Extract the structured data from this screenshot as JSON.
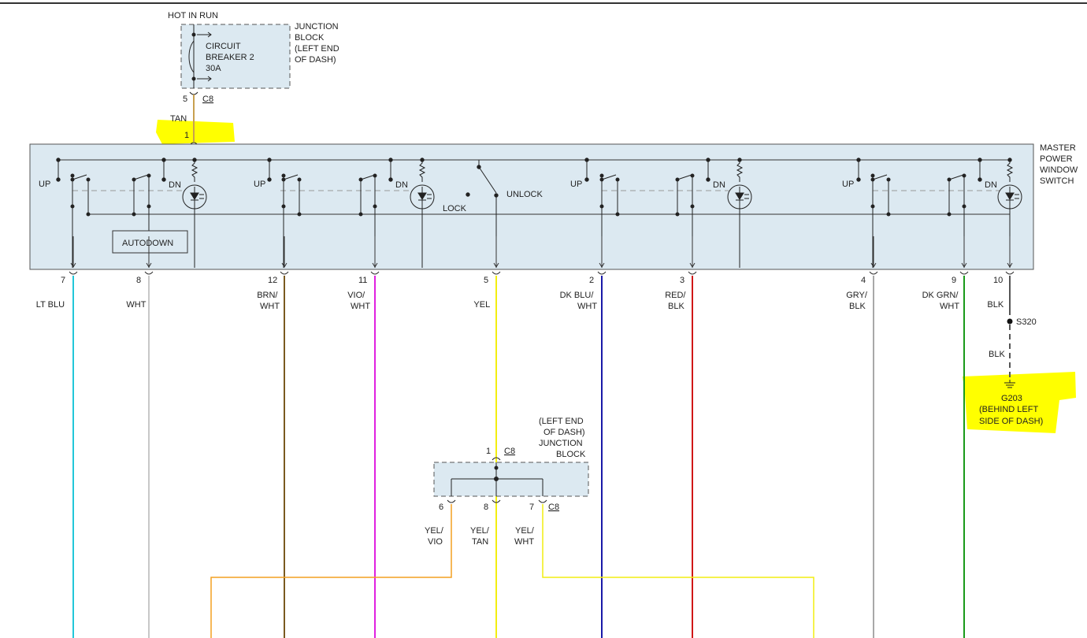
{
  "power": {
    "hot_in_run": "HOT IN RUN",
    "breaker_line1": "CIRCUIT",
    "breaker_line2": "BREAKER 2",
    "breaker_rating": "30A",
    "jb_line1": "JUNCTION",
    "jb_line2": "BLOCK",
    "jb_line3": "(LEFT END",
    "jb_line4": "OF DASH)",
    "out_pin": "5",
    "out_connector": "C8",
    "wire_color": "TAN",
    "switch_in_pin": "1"
  },
  "switch": {
    "name_line1": "MASTER",
    "name_line2": "POWER",
    "name_line3": "WINDOW",
    "name_line4": "SWITCH",
    "up_label": "UP",
    "dn_label": "DN",
    "autodown_label": "AUTODOWN",
    "lock_label": "LOCK",
    "unlock_label": "UNLOCK"
  },
  "pins": [
    {
      "pin": "7",
      "wire1": "LT BLU",
      "wire2": "",
      "color": "#22c7d9"
    },
    {
      "pin": "8",
      "wire1": "WHT",
      "wire2": "",
      "color": "#c8c8c8"
    },
    {
      "pin": "12",
      "wire1": "BRN/",
      "wire2": "WHT",
      "color": "#7a5a20"
    },
    {
      "pin": "11",
      "wire1": "VIO/",
      "wire2": "WHT",
      "color": "#e020e0"
    },
    {
      "pin": "5",
      "wire1": "YEL",
      "wire2": "",
      "color": "#f2ee10"
    },
    {
      "pin": "2",
      "wire1": "DK BLU/",
      "wire2": "WHT",
      "color": "#1a1aa8"
    },
    {
      "pin": "3",
      "wire1": "RED/",
      "wire2": "BLK",
      "color": "#d01818"
    },
    {
      "pin": "4",
      "wire1": "GRY/",
      "wire2": "BLK",
      "color": "#a8a8a8"
    },
    {
      "pin": "9",
      "wire1": "DK GRN/",
      "wire2": "WHT",
      "color": "#1a9a1a"
    },
    {
      "pin": "10",
      "wire1": "BLK",
      "wire2": "",
      "color": "#555555"
    }
  ],
  "ground": {
    "splice": "S320",
    "wire_color": "BLK",
    "ground_id": "G203",
    "loc_line1": "(BEHIND LEFT",
    "loc_line2": "SIDE OF DASH)"
  },
  "lower_junction": {
    "line1": "(LEFT END",
    "line2": "OF DASH)",
    "line3": "JUNCTION",
    "line4": "BLOCK",
    "in_pin": "1",
    "connector": "C8",
    "pin_left": "6",
    "pin_mid": "8",
    "pin_right": "7",
    "connector_right": "C8",
    "wire_left1": "YEL/",
    "wire_left2": "VIO",
    "wire_mid1": "YEL/",
    "wire_mid2": "TAN",
    "wire_right1": "YEL/",
    "wire_right2": "WHT"
  },
  "colors": {
    "highlight": "#ffff00",
    "switch_fill": "#dce9f1",
    "tan": "#c8a050",
    "yel_vio": "#f4a020",
    "yel_wht": "#f2ee10"
  }
}
